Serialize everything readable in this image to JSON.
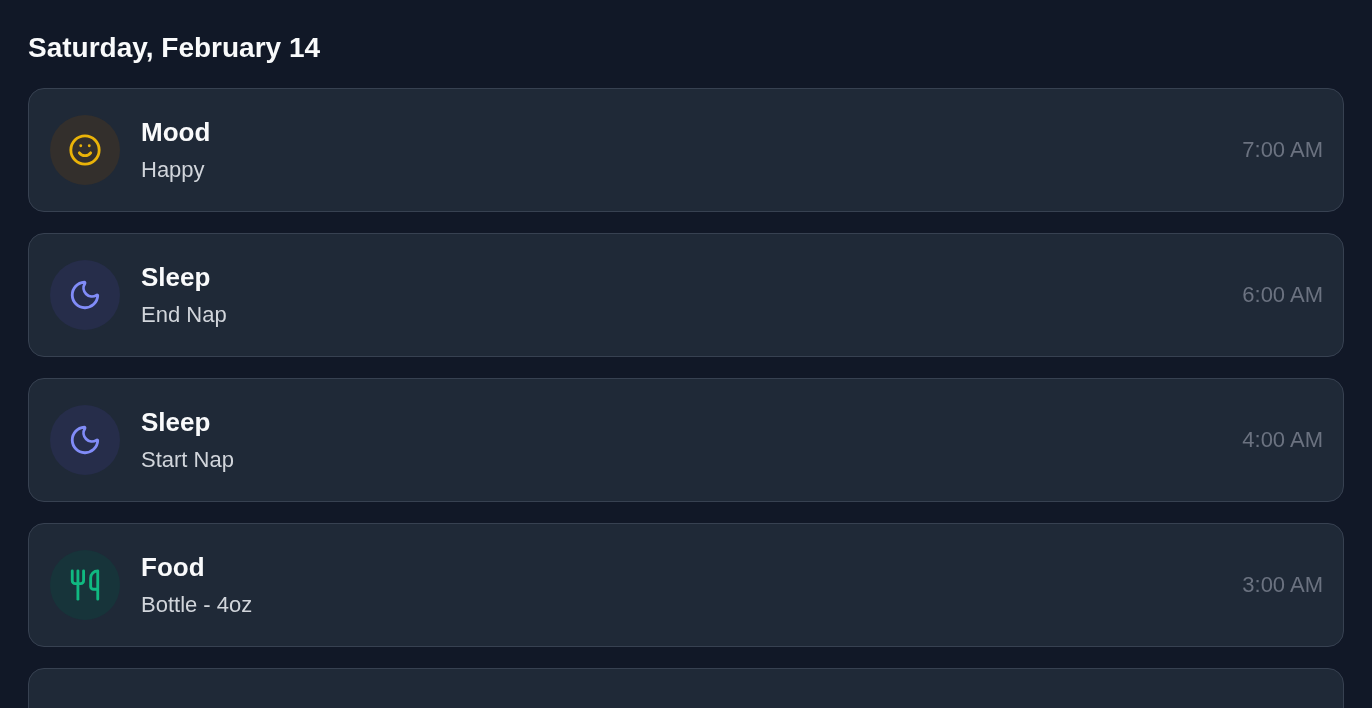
{
  "date_heading": "Saturday, February 14",
  "entries": [
    {
      "kind": "mood",
      "title": "Mood",
      "detail": "Happy",
      "time": "7:00 AM"
    },
    {
      "kind": "sleep",
      "title": "Sleep",
      "detail": "End Nap",
      "time": "6:00 AM"
    },
    {
      "kind": "sleep",
      "title": "Sleep",
      "detail": "Start Nap",
      "time": "4:00 AM"
    },
    {
      "kind": "food",
      "title": "Food",
      "detail": "Bottle - 4oz",
      "time": "3:00 AM"
    }
  ]
}
